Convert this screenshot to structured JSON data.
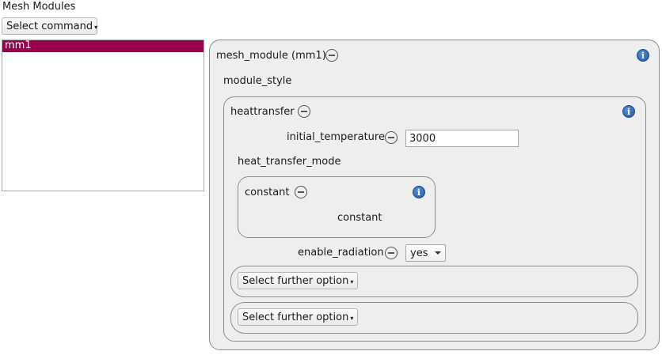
{
  "header": {
    "title": "Mesh Modules"
  },
  "command": {
    "label": "Select command"
  },
  "modules_list": {
    "items": [
      {
        "label": "mm1",
        "selected": true
      }
    ]
  },
  "mesh_module": {
    "title": "mesh_module (mm1)",
    "style_label": "module_style",
    "heattransfer": {
      "title": "heattransfer",
      "initial_temperature": {
        "label": "initial_temperature",
        "value": "3000"
      },
      "heat_transfer_mode": {
        "label": "heat_transfer_mode",
        "constant": {
          "title": "constant",
          "value": "constant"
        }
      },
      "enable_radiation": {
        "label": "enable_radiation",
        "value": "yes",
        "options": [
          "yes"
        ]
      },
      "further_options": [
        {
          "label": "Select further option"
        },
        {
          "label": "Select further option"
        }
      ]
    }
  },
  "icons": {
    "info": "i",
    "remove": "minus-circle-icon",
    "info_name": "info-icon"
  },
  "colors": {
    "selection": "#99004d",
    "panel": "#eeeeee",
    "info": "#1f55a8"
  }
}
